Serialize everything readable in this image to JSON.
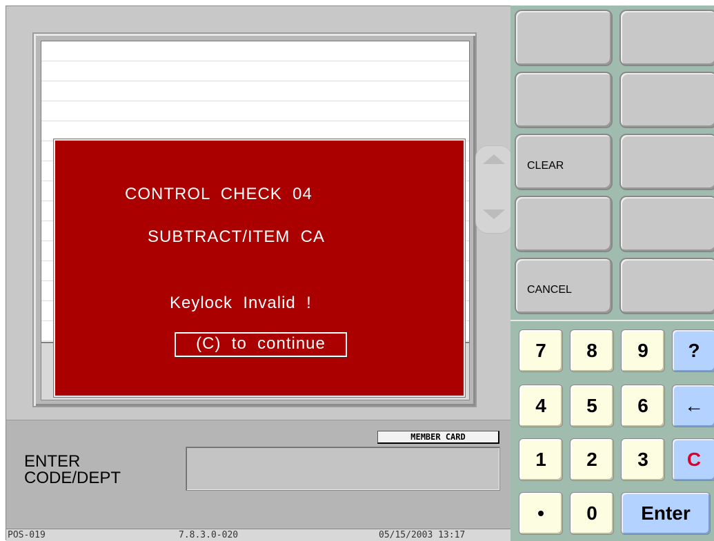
{
  "dialog": {
    "line1": "CONTROL  CHECK  04",
    "line2": "SUBTRACT/ITEM  CA",
    "line3": "Keylock  Invalid  !",
    "continue_label": "(C)  to  continue"
  },
  "member_card_label": "MEMBER CARD",
  "enter_label": "ENTER\nCODE/DEPT",
  "status": {
    "terminal": "POS-019",
    "version": "7.8.3.0-020",
    "datetime": "05/15/2003 13:17"
  },
  "function_keys": [
    "",
    "",
    "",
    "",
    "CLEAR",
    "",
    "",
    "",
    "CANCEL",
    ""
  ],
  "keypad": {
    "row1": [
      "7",
      "8",
      "9",
      "?"
    ],
    "row2": [
      "4",
      "5",
      "6",
      "←"
    ],
    "row3": [
      "1",
      "2",
      "3",
      "C"
    ],
    "row4": [
      "•",
      "0",
      "Enter"
    ]
  },
  "colors": {
    "dialog_bg": "#aa0000",
    "keypad_bg": "#9fbcae",
    "digit_key": "#fdfde2",
    "action_key": "#b4d2ff",
    "clear_key_text": "#e0002a"
  }
}
